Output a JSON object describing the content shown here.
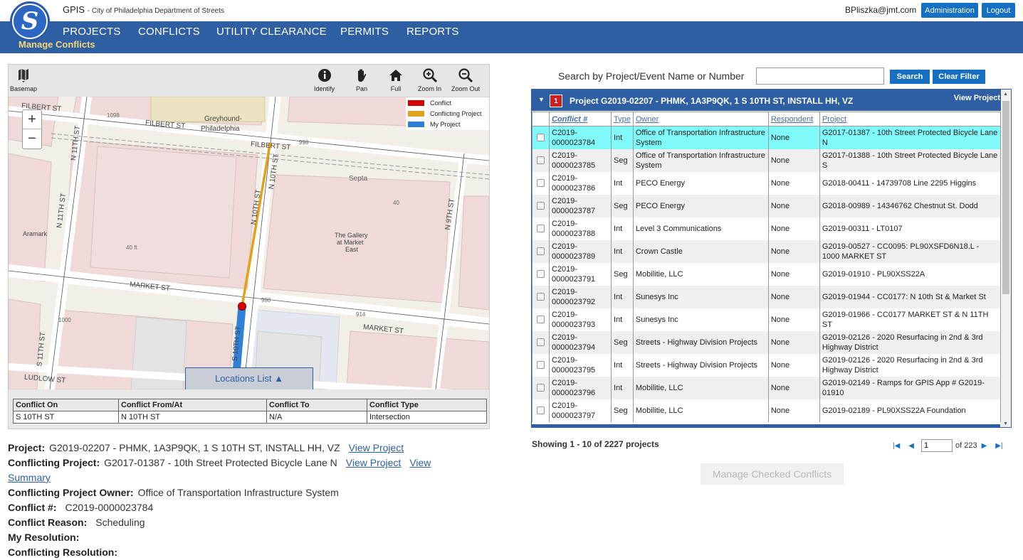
{
  "header": {
    "app_name": "GPIS",
    "app_subtitle": "City of Philadelphia Department of Streets",
    "logo_letter": "S",
    "user_email": "BPliszka@jmt.com",
    "admin_label": "Administration",
    "logout_label": "Logout"
  },
  "nav": {
    "items": [
      "PROJECTS",
      "CONFLICTS",
      "UTILITY CLEARANCE",
      "PERMITS",
      "REPORTS"
    ],
    "page_title": "Manage Conflicts"
  },
  "map": {
    "tools": {
      "basemap": "Basemap",
      "identify": "Identify",
      "pan": "Pan",
      "full": "Full",
      "zoom_in": "Zoom In",
      "zoom_out": "Zoom Out"
    },
    "zoom_plus": "+",
    "zoom_minus": "−",
    "legend": [
      {
        "label": "Conflict",
        "color": "#d40000"
      },
      {
        "label": "Conflicting Project",
        "color": "#e0a11b"
      },
      {
        "label": "My Project",
        "color": "#2f80d6"
      }
    ],
    "labels": {
      "filbert_st_top": "FILBERT ST",
      "filbert_st_mid": "FILBERT ST",
      "filbert_st_right": "FILBERT ST",
      "philadelphia": "Philadelphia",
      "greyhound": "Greyhound-",
      "n_11th_st": "N 11TH ST",
      "n_11th_st_2": "N 11TH ST",
      "n_10th_st": "N 10TH ST",
      "n_10th_st_2": "N 10TH ST",
      "n_9th_st": "N 9TH ST",
      "s_11th_st": "S 11TH ST",
      "s_10th_st": "S 10TH ST",
      "market_st": "MARKET ST",
      "market_st_2": "MARKET ST",
      "ludlow_st": "LUDLOW ST",
      "septa": "Septa",
      "gallery_1": "The Gallery",
      "gallery_2": "at Market",
      "gallery_3": "East",
      "aramark": "Aramark",
      "ft_40": "40 ft",
      "n_40": "40",
      "n_40b": "40",
      "n_998a": "998",
      "n_998b": "998",
      "n_1098": "1098",
      "n_914": "914",
      "n_1000": "1000"
    },
    "locations_list": "Locations List ▲",
    "conflict_table": {
      "headers": [
        "Conflict On",
        "Conflict From/At",
        "Conflict To",
        "Conflict Type"
      ],
      "row": [
        "S 10TH ST",
        "N 10TH ST",
        "N/A",
        "Intersection"
      ]
    }
  },
  "details": {
    "project_label": "Project:",
    "project_value": "G2019-02207 - PHMK, 1A3P9QK, 1 S 10TH ST, INSTALL HH, VZ",
    "view_project": "View Project",
    "conflicting_project_label": "Conflicting Project:",
    "conflicting_project_value": "G2017-01387 - 10th Street Protected Bicycle Lane N",
    "view_project_2": "View Project",
    "view_summary_1": "View",
    "view_summary_2": "Summary",
    "owner_label": "Conflicting Project Owner:",
    "owner_value": "Office of Transportation Infrastructure System",
    "conflict_no_label": "Conflict #:",
    "conflict_no_value": "C2019-0000023784",
    "reason_label": "Conflict Reason:",
    "reason_value": "Scheduling",
    "my_resolution_label": "My Resolution:",
    "conflicting_resolution_label": "Conflicting Resolution:"
  },
  "search": {
    "label": "Search by Project/Event Name or Number",
    "value": "",
    "search_button": "Search",
    "clear_button": "Clear Filter"
  },
  "grid": {
    "badge": "1",
    "caret": "▼",
    "title": "Project G2019-02207 - PHMK, 1A3P9QK, 1 S 10TH ST, INSTALL HH, VZ",
    "view_project": "View Project",
    "columns": [
      "Conflict #",
      "Type",
      "Owner",
      "Respondent",
      "Project"
    ],
    "rows": [
      {
        "no": "C2019-\n0000023784",
        "type": "Int",
        "owner": "Office of Transportation Infrastructure System",
        "resp": "None",
        "project": "G2017-01387 - 10th Street Protected Bicycle Lane N"
      },
      {
        "no": "C2019-\n0000023785",
        "type": "Seg",
        "owner": "Office of Transportation Infrastructure System",
        "resp": "None",
        "project": "G2017-01388 - 10th Street Protected Bicycle Lane S"
      },
      {
        "no": "C2019-\n0000023786",
        "type": "Int",
        "owner": "PECO Energy",
        "resp": "None",
        "project": "G2018-00411 - 14739708 Line 2295 Higgins"
      },
      {
        "no": "C2019-\n0000023787",
        "type": "Seg",
        "owner": "PECO Energy",
        "resp": "None",
        "project": "G2018-00989 - 14346762 Chestnut St. Dodd"
      },
      {
        "no": "C2019-\n0000023788",
        "type": "Int",
        "owner": "Level 3 Communications",
        "resp": "None",
        "project": "G2019-00311 - LT0107"
      },
      {
        "no": "C2019-\n0000023789",
        "type": "Int",
        "owner": "Crown Castle",
        "resp": "None",
        "project": "G2019-00527 - CC0095: PL90XSFD6N18.L - 1000 MARKET ST"
      },
      {
        "no": "C2019-\n0000023791",
        "type": "Seg",
        "owner": "Mobilitie, LLC",
        "resp": "None",
        "project": "G2019-01910 - PL90XSS22A"
      },
      {
        "no": "C2019-\n0000023792",
        "type": "Int",
        "owner": "Sunesys Inc",
        "resp": "None",
        "project": "G2019-01944 - CC0177: N 10th St & Market St"
      },
      {
        "no": "C2019-\n0000023793",
        "type": "Int",
        "owner": "Sunesys Inc",
        "resp": "None",
        "project": "G2019-01966 - CC0177 MARKET ST & N 11TH ST"
      },
      {
        "no": "C2019-\n0000023794",
        "type": "Seg",
        "owner": "Streets - Highway Division Projects",
        "resp": "None",
        "project": "G2019-02126 - 2020 Resurfacing in 2nd & 3rd Highway District"
      },
      {
        "no": "C2019-\n0000023795",
        "type": "Int",
        "owner": "Streets - Highway Division Projects",
        "resp": "None",
        "project": "G2019-02126 - 2020 Resurfacing in 2nd & 3rd Highway District"
      },
      {
        "no": "C2019-\n0000023796",
        "type": "Int",
        "owner": "Mobilitie, LLC",
        "resp": "None",
        "project": "G2019-02149 - Ramps for GPIS App # G2019-01910"
      },
      {
        "no": "C2019-\n0000023797",
        "type": "Seg",
        "owner": "Mobilitie, LLC",
        "resp": "None",
        "project": "G2019-02189 - PL90XSS22A Foundation"
      }
    ],
    "showing": "Showing 1 - 10 of 2227 projects",
    "page_value": "1",
    "page_of": "of 223",
    "manage_button": "Manage Checked Conflicts"
  }
}
